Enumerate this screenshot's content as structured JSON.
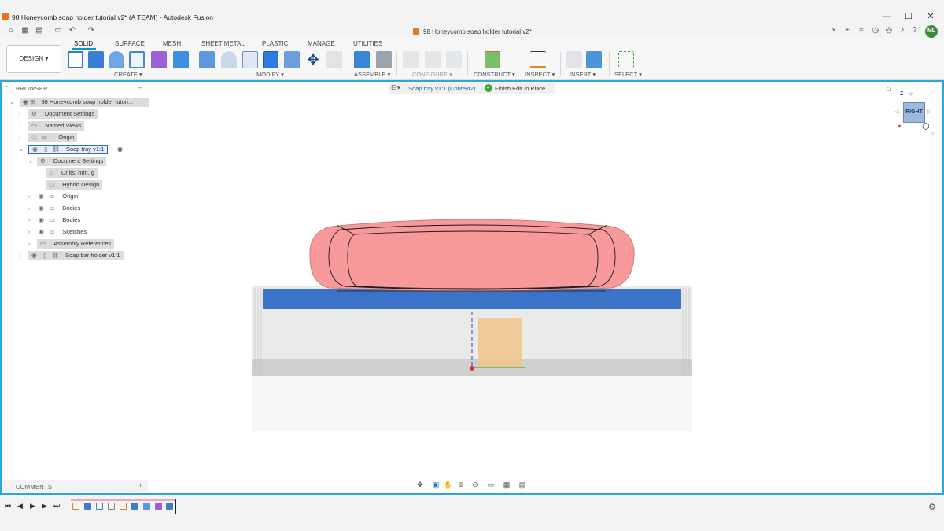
{
  "window": {
    "title": "98 Honeycomb soap holder tutorial v2* (A TEAM) - Autodesk Fusion",
    "minimize": "—",
    "maximize": "☐",
    "close": "✕"
  },
  "document_tab": {
    "title": "98 Honeycomb soap holder tutorial v2*",
    "close": "×"
  },
  "user": {
    "initials": "ML"
  },
  "workspace": {
    "label": "DESIGN ▾"
  },
  "ribbon": {
    "tabs": [
      "SOLID",
      "SURFACE",
      "MESH",
      "SHEET METAL",
      "PLASTIC",
      "MANAGE",
      "UTILITIES"
    ],
    "active_tab": "SOLID",
    "groups": [
      "CREATE ▾",
      "MODIFY ▾",
      "ASSEMBLE ▾",
      "CONFIGURE ▾",
      "CONSTRUCT ▾",
      "INSPECT ▾",
      "INSERT ▾",
      "SELECT ▾"
    ]
  },
  "browser": {
    "title": "BROWSER",
    "collapse": "–",
    "items": [
      {
        "label": "98 Honeycomb soap holder tutori..."
      },
      {
        "label": "Document Settings"
      },
      {
        "label": "Named Views"
      },
      {
        "label": "Origin"
      },
      {
        "label": "Soap tray v1:1"
      },
      {
        "label": "Document Settings"
      },
      {
        "label": "Units: mm, g"
      },
      {
        "label": "Hybrid Design"
      },
      {
        "label": "Origin"
      },
      {
        "label": "Bodies"
      },
      {
        "label": "Bodies"
      },
      {
        "label": "Sketches"
      },
      {
        "label": "Assembly References"
      },
      {
        "label": "Soap bar holder v1:1"
      }
    ]
  },
  "context": {
    "component": "Soap tray v1:1 (Context2)",
    "finish": "Finish Edit In Place"
  },
  "viewcube": {
    "face": "RIGHT",
    "axis": "Z"
  },
  "comments": {
    "title": "COMMENTS",
    "add": "+"
  },
  "colors": {
    "accent": "#2aa7de",
    "soap_body": "#f8999b",
    "tray_top": "#3b73c8",
    "sketch_fill": "#f1c489"
  }
}
